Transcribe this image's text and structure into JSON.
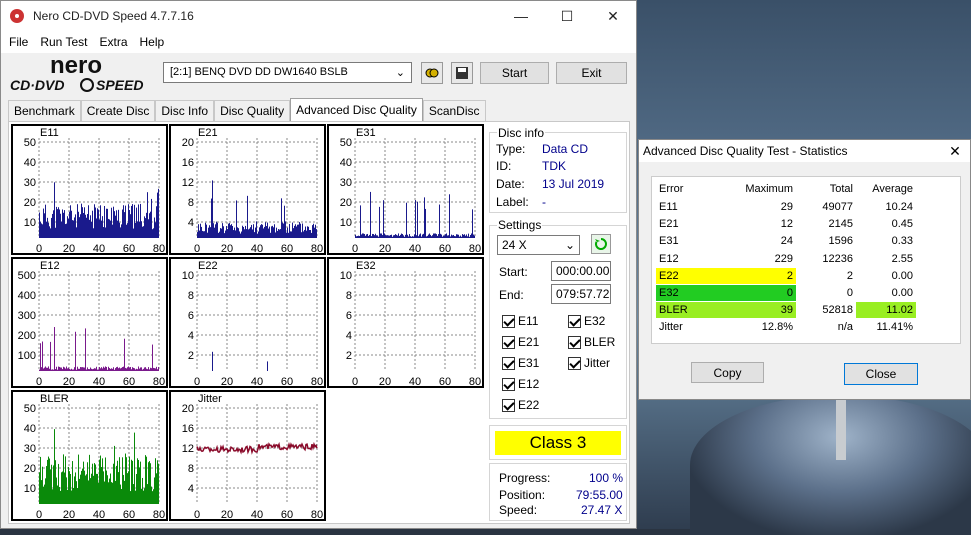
{
  "window": {
    "title": "Nero CD-DVD Speed 4.7.7.16",
    "minimize": "—",
    "maximize": "☐",
    "close": "✕"
  },
  "menu": [
    "File",
    "Run Test",
    "Extra",
    "Help"
  ],
  "toolbar": {
    "drive": "[2:1]   BENQ DVD DD DW1640 BSLB",
    "start_label": "Start",
    "exit_label": "Exit"
  },
  "tabs": [
    "Benchmark",
    "Create Disc",
    "Disc Info",
    "Disc Quality",
    "Advanced Disc Quality",
    "ScanDisc"
  ],
  "active_tab": "Advanced Disc Quality",
  "disc_info": {
    "group_label": "Disc info",
    "type_label": "Type:",
    "type": "Data CD",
    "id_label": "ID:",
    "id": "TDK",
    "date_label": "Date:",
    "date": "13 Jul 2019",
    "label_label": "Label:",
    "label": "-"
  },
  "settings": {
    "group_label": "Settings",
    "speed": "24 X",
    "start_label": "Start:",
    "start": "000:00.00",
    "end_label": "End:",
    "end": "079:57.72",
    "checkboxes": [
      "E11",
      "E32",
      "E21",
      "BLER",
      "E31",
      "Jitter",
      "E12",
      "E22"
    ]
  },
  "class_label": "Class 3",
  "progress": {
    "progress_label": "Progress:",
    "progress": "100 %",
    "position_label": "Position:",
    "position": "79:55.00",
    "speed_label": "Speed:",
    "speed": "27.47 X"
  },
  "chart_data": [
    {
      "type": "bar",
      "title": "E11",
      "yticks": [
        "50",
        "40",
        "30",
        "20",
        "10"
      ],
      "ylim": [
        0,
        50
      ],
      "xticks": [
        "0",
        "20",
        "40",
        "60",
        "80"
      ],
      "color": "#1a1a8c",
      "baseline": 15,
      "peak": 29
    },
    {
      "type": "bar",
      "title": "E21",
      "yticks": [
        "20",
        "16",
        "12",
        "8",
        "4"
      ],
      "ylim": [
        0,
        20
      ],
      "xticks": [
        "0",
        "20",
        "40",
        "60",
        "80"
      ],
      "color": "#1a1a8c",
      "baseline": 3,
      "peak": 12
    },
    {
      "type": "bar",
      "title": "E31",
      "yticks": [
        "50",
        "40",
        "30",
        "20",
        "10"
      ],
      "ylim": [
        0,
        50
      ],
      "xticks": [
        "0",
        "20",
        "40",
        "60",
        "80"
      ],
      "color": "#1a1a8c",
      "baseline": 2,
      "peak": 24
    },
    {
      "type": "bar",
      "title": "E12",
      "yticks": [
        "500",
        "400",
        "300",
        "200",
        "100"
      ],
      "ylim": [
        0,
        500
      ],
      "xticks": [
        "0",
        "20",
        "40",
        "60",
        "80"
      ],
      "color": "#7a1a8c",
      "baseline": 20,
      "peak": 229
    },
    {
      "type": "bar",
      "title": "E22",
      "yticks": [
        "10",
        "8",
        "6",
        "4",
        "2"
      ],
      "ylim": [
        0,
        10
      ],
      "xticks": [
        "0",
        "20",
        "40",
        "60",
        "80"
      ],
      "color": "#1a1a8c",
      "baseline": 0,
      "peak": 2
    },
    {
      "type": "bar",
      "title": "E32",
      "yticks": [
        "10",
        "8",
        "6",
        "4",
        "2"
      ],
      "ylim": [
        0,
        10
      ],
      "xticks": [
        "0",
        "20",
        "40",
        "60",
        "80"
      ],
      "color": "#1a1a8c",
      "baseline": 0,
      "peak": 0
    },
    {
      "type": "bar",
      "title": "BLER",
      "yticks": [
        "50",
        "40",
        "30",
        "20",
        "10"
      ],
      "ylim": [
        0,
        50
      ],
      "xticks": [
        "0",
        "20",
        "40",
        "60",
        "80"
      ],
      "color": "#0a8a0a",
      "baseline": 22,
      "peak": 39
    },
    {
      "type": "line",
      "title": "Jitter",
      "yticks": [
        "20",
        "16",
        "12",
        "8",
        "4"
      ],
      "ylim": [
        0,
        20
      ],
      "xticks": [
        "0",
        "20",
        "40",
        "60",
        "80"
      ],
      "color": "#8a0a2a",
      "baseline": 11.4,
      "peak": 12.8
    }
  ],
  "stats": {
    "title": "Advanced Disc Quality Test - Statistics",
    "headers": [
      "Error",
      "Maximum",
      "Total",
      "Average"
    ],
    "rows": [
      {
        "name": "E11",
        "max": "29",
        "total": "49077",
        "avg": "10.24",
        "hl": "",
        "hlavg": ""
      },
      {
        "name": "E21",
        "max": "12",
        "total": "2145",
        "avg": "0.45",
        "hl": "",
        "hlavg": ""
      },
      {
        "name": "E31",
        "max": "24",
        "total": "1596",
        "avg": "0.33",
        "hl": "",
        "hlavg": ""
      },
      {
        "name": "E12",
        "max": "229",
        "total": "12236",
        "avg": "2.55",
        "hl": "",
        "hlavg": ""
      },
      {
        "name": "E22",
        "max": "2",
        "total": "2",
        "avg": "0.00",
        "hl": "#ffff00",
        "hlavg": ""
      },
      {
        "name": "E32",
        "max": "0",
        "total": "0",
        "avg": "0.00",
        "hl": "#22cc22",
        "hlavg": ""
      },
      {
        "name": "BLER",
        "max": "39",
        "total": "52818",
        "avg": "11.02",
        "hl": "#99ee22",
        "hlavg": "#99ee22"
      },
      {
        "name": "Jitter",
        "max": "12.8%",
        "total": "n/a",
        "avg": "11.41%",
        "hl": "",
        "hlavg": ""
      }
    ],
    "copy_label": "Copy",
    "close_label": "Close"
  }
}
